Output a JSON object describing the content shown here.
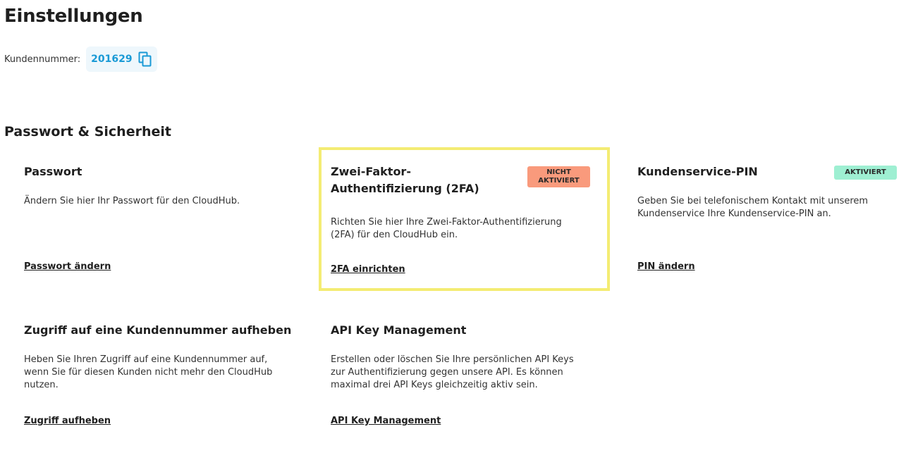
{
  "page": {
    "title": "Einstellungen",
    "customer_label": "Kundennummer:",
    "customer_number": "201629",
    "copy_icon": "copy-icon"
  },
  "section": {
    "title": "Passwort & Sicherheit"
  },
  "cards": {
    "password": {
      "title": "Passwort",
      "description": "Ändern Sie hier Ihr Passwort für den CloudHub.",
      "link": "Passwort ändern"
    },
    "twofa": {
      "title_line1": "Zwei-Faktor-",
      "title_line2": "Authentifizierung (2FA)",
      "badge_line1": "NICHT",
      "badge_line2": "AKTIVIERT",
      "description": "Richten Sie hier Ihre Zwei-Faktor-Authentifizierung (2FA) für den CloudHub ein.",
      "link": "2FA einrichten"
    },
    "pin": {
      "title": "Kundenservice-PIN",
      "badge": "AKTIVIERT",
      "description": "Geben Sie bei telefonischem Kontakt mit unserem Kundenservice Ihre Kundenservice-PIN an.",
      "link": "PIN ändern"
    },
    "revoke": {
      "title": "Zugriff auf eine Kundennummer aufheben",
      "description": "Heben Sie Ihren Zugriff auf eine Kundennummer auf, wenn Sie für diesen Kunden nicht mehr den CloudHub nutzen.",
      "link": "Zugriff aufheben"
    },
    "api": {
      "title": "API Key Management",
      "description": "Erstellen oder löschen Sie Ihre persönlichen API Keys zur Authentifizierung gegen unsere API. Es können maximal drei API Keys gleichzeitig aktiv sein.",
      "link": "API Key Management"
    }
  },
  "colors": {
    "accent_blue": "#1a9ad6",
    "highlight_border": "#f4ec73",
    "badge_inactive": "#f99a7c",
    "badge_active": "#9eefd2"
  }
}
